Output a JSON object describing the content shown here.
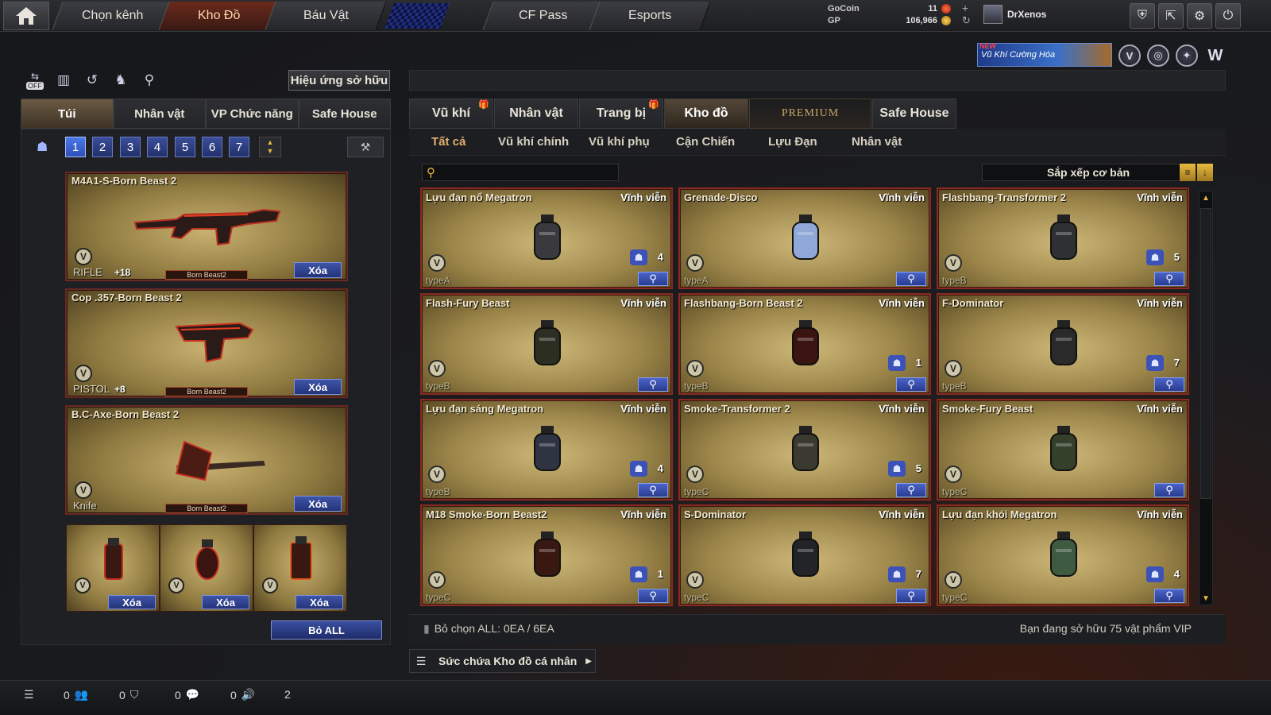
{
  "topbar": {
    "tabs": [
      "Chọn kênh",
      "Kho Đồ",
      "Báu Vật",
      "CF Pass",
      "Esports"
    ],
    "active_tab": "Kho Đồ",
    "gocoin_label": "GoCoin",
    "gp_label": "GP",
    "gocoin_value": "11",
    "gp_value": "106,966",
    "username": "DrXenos"
  },
  "banner": {
    "new_tag": "NEW",
    "text": "Vũ Khí Cường Hóa"
  },
  "left": {
    "owned_effects_button": "Hiệu ứng sở hữu",
    "tool_off_label": "OFF",
    "tabs": [
      "Túi",
      "Nhân vật",
      "VP Chức năng",
      "Safe House"
    ],
    "pages": [
      "1",
      "2",
      "3",
      "4",
      "5",
      "6",
      "7"
    ],
    "loadout": [
      {
        "name": "M4A1-S-Born Beast 2",
        "type": "RIFLE",
        "plus": "+18",
        "brand": "Born Beast2",
        "delete": "Xóa"
      },
      {
        "name": "Cop .357-Born Beast 2",
        "type": "PISTOL",
        "plus": "+8",
        "brand": "Born Beast2",
        "delete": "Xóa"
      },
      {
        "name": "B.C-Axe-Born Beast 2",
        "type": "Knife",
        "plus": "",
        "brand": "Born Beast2",
        "delete": "Xóa"
      }
    ],
    "grenade_slots": [
      {
        "delete": "Xóa"
      },
      {
        "delete": "Xóa"
      },
      {
        "delete": "Xóa"
      }
    ],
    "remove_all": "Bỏ ALL"
  },
  "right": {
    "tabs": [
      "Vũ khí",
      "Nhân vật",
      "Trang bị",
      "Kho đồ",
      "PREMIUM",
      "Safe House"
    ],
    "subtabs": [
      "Tất cả",
      "Vũ khí chính",
      "Vũ khí phụ",
      "Cận Chiến",
      "Lựu Đạn",
      "Nhân vật"
    ],
    "search_placeholder": "",
    "sort_label": "Sắp xếp cơ bản",
    "items": [
      {
        "name": "Lựu đạn nổ Megatron",
        "duration": "Vĩnh viễn",
        "type": "typeA",
        "count": "4",
        "color": "#3a3a3e"
      },
      {
        "name": "Grenade-Disco",
        "duration": "Vĩnh viễn",
        "type": "typeA",
        "count": "",
        "color": "#8fa8d8"
      },
      {
        "name": "Flashbang-Transformer 2",
        "duration": "Vĩnh viễn",
        "type": "typeB",
        "count": "5",
        "color": "#2e3032"
      },
      {
        "name": "Flash-Fury Beast",
        "duration": "Vĩnh viễn",
        "type": "typeB",
        "count": "",
        "color": "#2c2e22"
      },
      {
        "name": "Flashbang-Born Beast 2",
        "duration": "Vĩnh viễn",
        "type": "typeB",
        "count": "1",
        "color": "#3a1410"
      },
      {
        "name": "F-Dominator",
        "duration": "Vĩnh viễn",
        "type": "typeB",
        "count": "7",
        "color": "#2a2a2a"
      },
      {
        "name": "Lựu đạn sáng Megatron",
        "duration": "Vĩnh viễn",
        "type": "typeB",
        "count": "4",
        "color": "#2e3442"
      },
      {
        "name": "Smoke-Transformer 2",
        "duration": "Vĩnh viễn",
        "type": "typeC",
        "count": "5",
        "color": "#3a3a30"
      },
      {
        "name": "Smoke-Fury Beast",
        "duration": "Vĩnh viễn",
        "type": "typeC",
        "count": "",
        "color": "#34402a"
      },
      {
        "name": "M18 Smoke-Born Beast2",
        "duration": "Vĩnh viễn",
        "type": "typeC",
        "count": "1",
        "color": "#3a1812"
      },
      {
        "name": "S-Dominator",
        "duration": "Vĩnh viễn",
        "type": "typeC",
        "count": "7",
        "color": "#222428"
      },
      {
        "name": "Lựu đạn khói Megatron",
        "duration": "Vĩnh viễn",
        "type": "typeC",
        "count": "4",
        "color": "#3e5a40"
      }
    ],
    "info_left": "Bỏ chọn ALL: 0EA / 6EA",
    "info_right": "Bạn đang sở hữu 75 vật phẩm VIP",
    "storage_label": "Sức chứa Kho đồ cá nhân"
  },
  "bottombar": {
    "values": [
      "0",
      "0",
      "0",
      "0",
      "2"
    ]
  },
  "colors": {
    "accent_gold": "#e8b840",
    "card_border": "#8a2a20",
    "button_blue": "#3f54a8"
  }
}
